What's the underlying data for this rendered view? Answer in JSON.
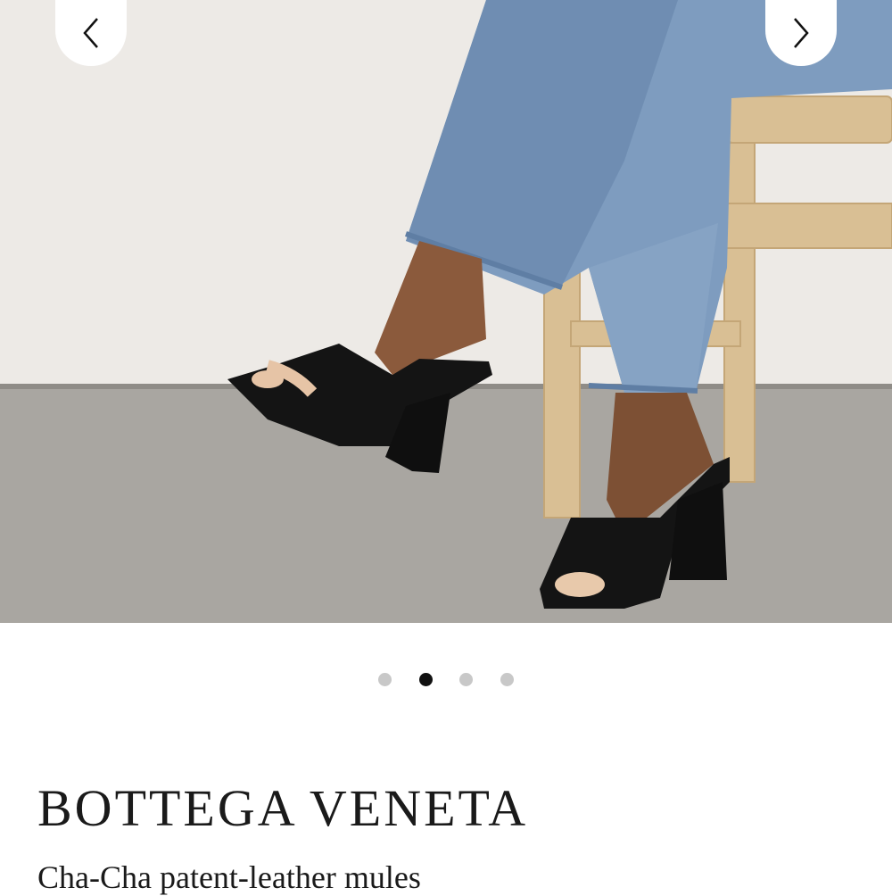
{
  "gallery": {
    "image_alt": "Model wearing black patent-leather mules with sculpted heels, seated on a wooden chair",
    "prev_icon": "chevron-left-icon",
    "next_icon": "chevron-right-icon",
    "total_images": 4,
    "active_index": 1
  },
  "product": {
    "brand": "BOTTEGA VENETA",
    "name": "Cha-Cha patent-leather mules"
  },
  "colors": {
    "dot_active": "#111111",
    "dot_inactive": "#c8c8c8",
    "text": "#1a1a1a"
  }
}
